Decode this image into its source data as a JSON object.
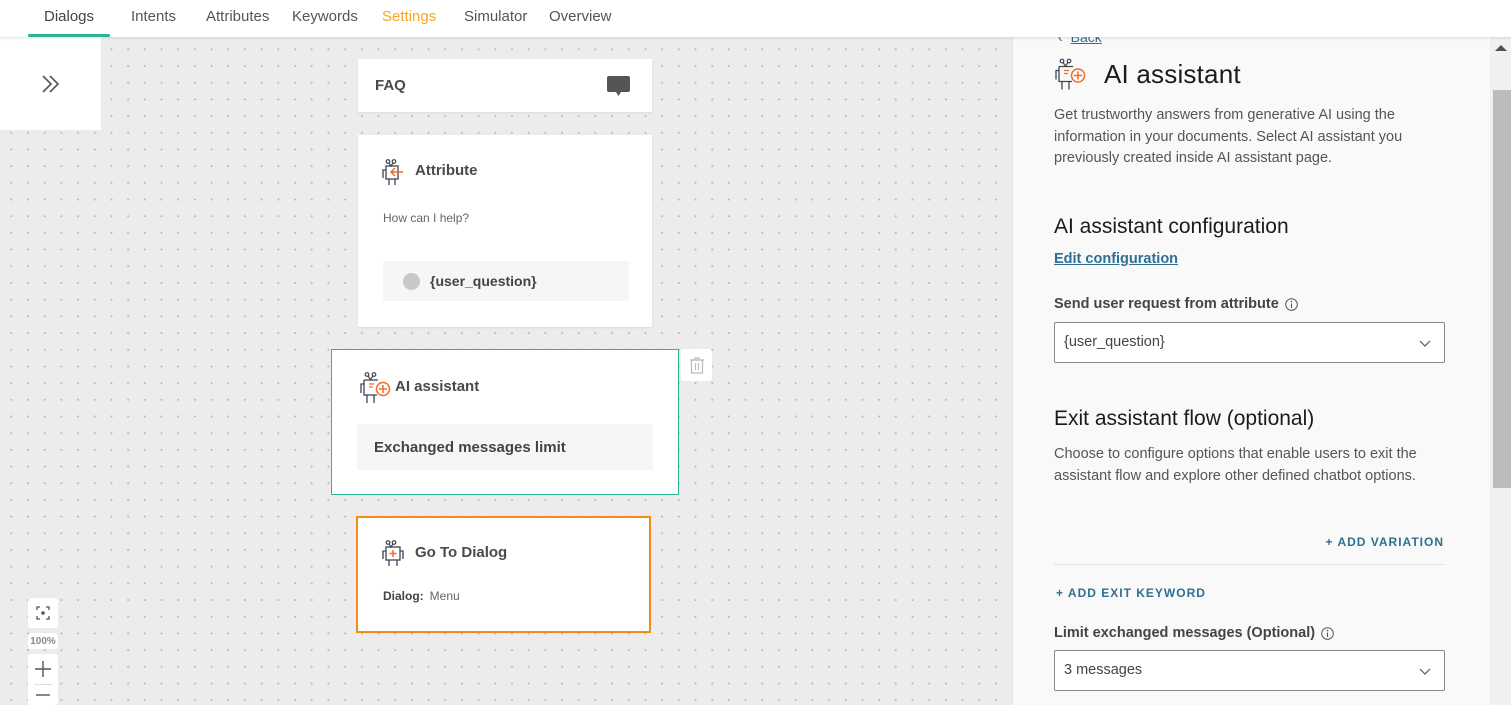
{
  "nav": {
    "tabs": [
      {
        "label": "Dialogs",
        "state": "active"
      },
      {
        "label": "Intents"
      },
      {
        "label": "Attributes"
      },
      {
        "label": "Keywords"
      },
      {
        "label": "Settings",
        "state": "highlight"
      },
      {
        "label": "Simulator"
      },
      {
        "label": "Overview"
      }
    ]
  },
  "colors": {
    "accent_green": "#2bb594",
    "accent_orange": "#f28c18",
    "settings_tab": "#f5a623",
    "link_blue": "#2e6f93"
  },
  "canvas": {
    "expand_icon": "double-chevron-right-icon",
    "nodes": {
      "faq": {
        "title": "FAQ",
        "icon": "chat-bubble-icon"
      },
      "attribute": {
        "title": "Attribute",
        "prompt": "How can I help?",
        "attribute_chip": "{user_question}"
      },
      "ai_assistant": {
        "title": "AI assistant",
        "limit_label": "Exchanged messages limit",
        "selected": true
      },
      "go_to_dialog": {
        "title": "Go To Dialog",
        "meta_label": "Dialog:",
        "meta_value": "Menu"
      }
    },
    "delete_icon": "trash-icon",
    "zoom": {
      "level": "100%",
      "fit_icon": "fit-screen-icon",
      "plus": "+",
      "minus": "−"
    }
  },
  "panel": {
    "back_label": "Back",
    "title": "AI assistant",
    "description": "Get trustworthy answers from generative AI using the information in your documents. Select AI assistant you previously created inside AI assistant page.",
    "config_heading": "AI assistant configuration",
    "edit_config_label": "Edit configuration",
    "send_request_label": "Send user request from attribute",
    "send_request_value": "{user_question}",
    "exit_heading": "Exit assistant flow (optional)",
    "exit_description": "Choose to configure options that enable users to exit the assistant flow and explore other defined chatbot options.",
    "add_variation_label": "+ ADD VARIATION",
    "add_exit_keyword_label": "+ ADD EXIT KEYWORD",
    "limit_label": "Limit exchanged messages (Optional)",
    "limit_value": "3 messages"
  }
}
